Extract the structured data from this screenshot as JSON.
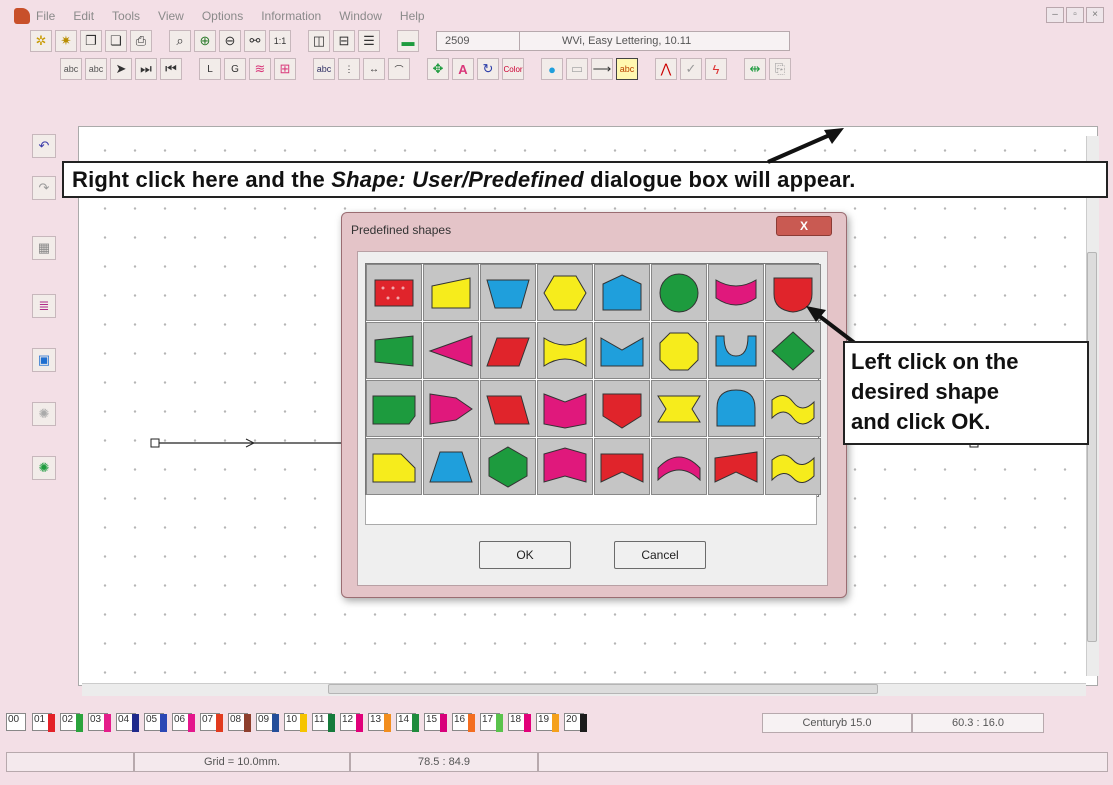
{
  "menu": [
    "File",
    "Edit",
    "Tools",
    "View",
    "Options",
    "Information",
    "Window",
    "Help"
  ],
  "toolbar": {
    "stitch_count": "2509",
    "font_info": "WVi, Easy Lettering, 10.11",
    "text_btn_labels": [
      "abc",
      "abc",
      "abc",
      "Color",
      "abc"
    ]
  },
  "callouts": {
    "top_prefix": "Right click here and the ",
    "top_italic": "Shape: User/Predefined",
    "top_suffix": " dialogue box will appear.",
    "side_line1": "Left click on the",
    "side_line2": "desired shape",
    "side_line3": "and click OK."
  },
  "dialog": {
    "title": "Predefined shapes",
    "close_label": "X",
    "ok_label": "OK",
    "cancel_label": "Cancel"
  },
  "shape_colors": {
    "red": "#e0242b",
    "yellow": "#f6ec1c",
    "blue": "#1f9fdc",
    "green": "#1d9b3e",
    "magenta": "#e0187c"
  },
  "palette": {
    "labels": [
      "00",
      "01",
      "02",
      "03",
      "04",
      "05",
      "06",
      "07",
      "08",
      "09",
      "10",
      "11",
      "12",
      "13",
      "14",
      "15",
      "16",
      "17",
      "18",
      "19",
      "20"
    ],
    "colors": [
      "#ffffff",
      "#e32128",
      "#2aa33c",
      "#e51d8b",
      "#1f2a8c",
      "#2b48b5",
      "#e4168c",
      "#e23b1e",
      "#8e3f2d",
      "#244e9a",
      "#f6c400",
      "#157a3b",
      "#e1007a",
      "#f28e1e",
      "#1f8c3d",
      "#d8007b",
      "#f36d20",
      "#5ac34c",
      "#e2007a",
      "#f5a11b",
      "#1c1c1c"
    ]
  },
  "status": {
    "font_field": "Centuryb 15.0",
    "size_field": "60.3 : 16.0",
    "grid": "Grid = 10.0mm.",
    "coords": "78.5 : 84.9"
  }
}
